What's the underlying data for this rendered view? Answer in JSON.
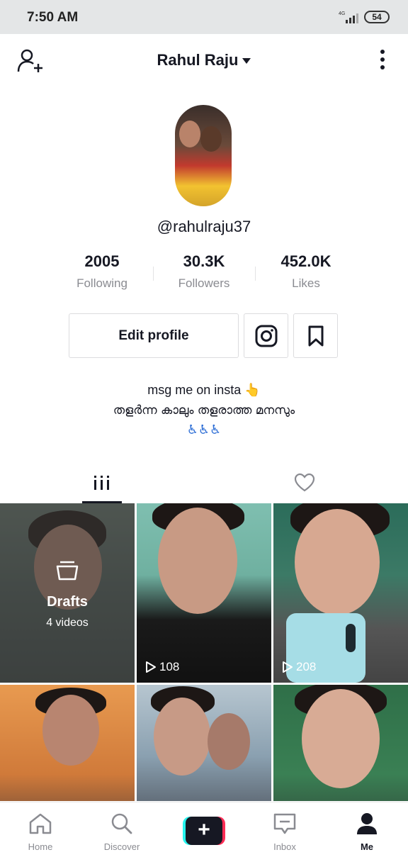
{
  "status_bar": {
    "time": "7:50 AM",
    "network": "4G",
    "battery": "54"
  },
  "header": {
    "title": "Rahul Raju",
    "add_friend_icon": "add-user-icon",
    "more_icon": "more-vertical-icon"
  },
  "profile": {
    "username": "@rahulraju37",
    "stats": [
      {
        "value": "2005",
        "label": "Following"
      },
      {
        "value": "30.3K",
        "label": "Followers"
      },
      {
        "value": "452.0K",
        "label": "Likes"
      }
    ],
    "edit_label": "Edit profile",
    "bio": {
      "line1": "msg me on insta 👆",
      "line2": "തളർന്ന കാലും തളരാത്ത മനസും",
      "line3": "♿♿♿"
    }
  },
  "tabs": [
    {
      "name": "videos",
      "icon": "grid-icon",
      "active": true
    },
    {
      "name": "liked",
      "icon": "heart-icon",
      "active": false
    }
  ],
  "grid": {
    "drafts": {
      "title": "Drafts",
      "count": "4 videos"
    },
    "videos": [
      {
        "views": "108"
      },
      {
        "views": "208"
      },
      {
        "views": ""
      },
      {
        "views": ""
      },
      {
        "views": ""
      }
    ]
  },
  "bottom_nav": [
    {
      "label": "Home",
      "icon": "home-icon"
    },
    {
      "label": "Discover",
      "icon": "search-icon"
    },
    {
      "label": "",
      "icon": "plus-icon"
    },
    {
      "label": "Inbox",
      "icon": "inbox-icon"
    },
    {
      "label": "Me",
      "icon": "person-icon"
    }
  ],
  "colors": {
    "accent_red": "#fe2c55",
    "accent_cyan": "#25f4ee",
    "text_primary": "#161823",
    "text_secondary": "#8a8b91"
  }
}
